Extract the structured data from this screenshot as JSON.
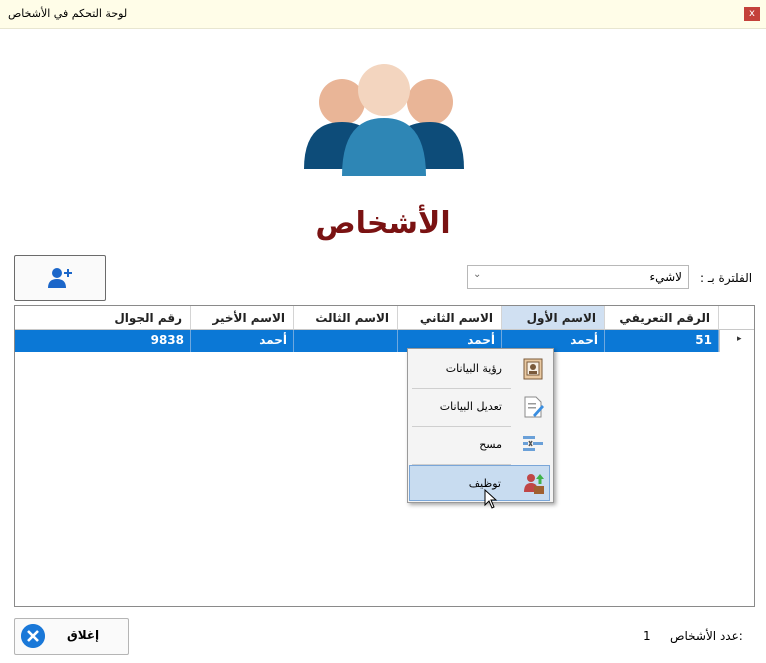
{
  "window": {
    "title": "لوحة التحكم في الأشخاص",
    "close_glyph": "x"
  },
  "page": {
    "title": "الأشخاص"
  },
  "filter": {
    "label": "الفلترة بـ :",
    "selected": "لاشيء"
  },
  "grid": {
    "columns": [
      "الرقم التعريفي",
      "الاسم الأول",
      "الاسم الثاني",
      "الاسم الثالث",
      "الاسم الأخير",
      "رقم الجوال"
    ],
    "rows": [
      {
        "id": "51",
        "first": "أحمد",
        "second": "أحمد",
        "third": "",
        "last": "أحمد",
        "phone": "9838"
      }
    ],
    "row_marker": "▸"
  },
  "context_menu": {
    "items": [
      {
        "label": "رؤية البيانات",
        "icon": "id-card-icon"
      },
      {
        "label": "تعديل البيانات",
        "icon": "edit-document-icon"
      },
      {
        "label": "مسح",
        "icon": "delete-list-icon"
      },
      {
        "label": "توظيف",
        "icon": "hire-person-icon"
      }
    ]
  },
  "footer": {
    "close_label": "إغلاق",
    "count_label": "عدد الأشخاص:",
    "count_value": "1"
  },
  "colors": {
    "accent": "#0b78d6",
    "title": "#7a1212",
    "hover": "#c8dcf0"
  }
}
